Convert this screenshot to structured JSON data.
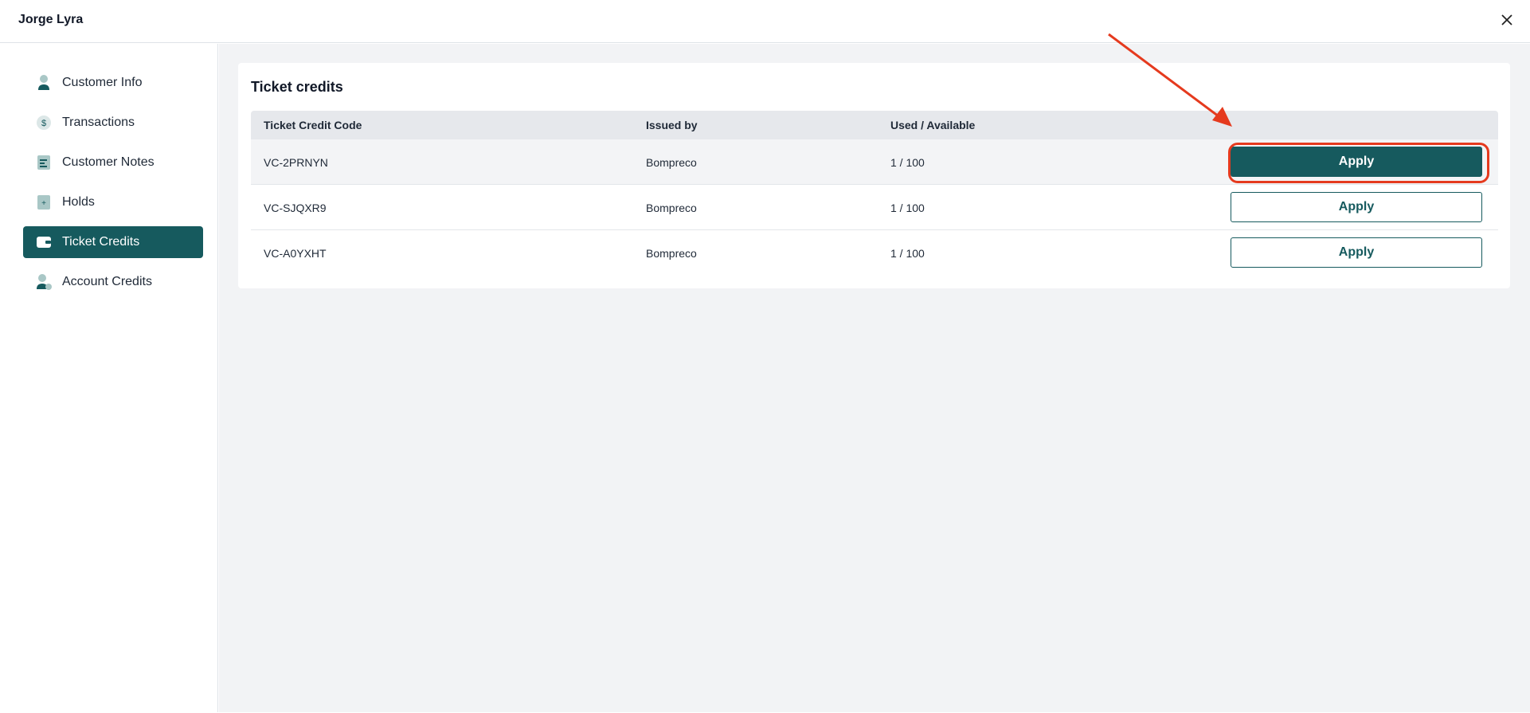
{
  "header": {
    "title": "Jorge Lyra",
    "close_icon": "close-icon"
  },
  "sidebar": {
    "items": [
      {
        "label": "Customer Info",
        "icon": "person-icon",
        "active": false
      },
      {
        "label": "Transactions",
        "icon": "dollar-icon",
        "active": false
      },
      {
        "label": "Customer Notes",
        "icon": "notes-icon",
        "active": false
      },
      {
        "label": "Holds",
        "icon": "hold-icon",
        "active": false
      },
      {
        "label": "Ticket Credits",
        "icon": "wallet-icon",
        "active": true
      },
      {
        "label": "Account Credits",
        "icon": "account-credit-icon",
        "active": false
      }
    ]
  },
  "main": {
    "card_title": "Ticket credits",
    "table": {
      "headers": [
        "Ticket Credit Code",
        "Issued by",
        "Used / Available"
      ],
      "rows": [
        {
          "code": "VC-2PRNYN",
          "issued_by": "Bompreco",
          "used_available": "1 / 100",
          "action": "Apply"
        },
        {
          "code": "VC-SJQXR9",
          "issued_by": "Bompreco",
          "used_available": "1 / 100",
          "action": "Apply"
        },
        {
          "code": "VC-A0YXHT",
          "issued_by": "Bompreco",
          "used_available": "1 / 100",
          "action": "Apply"
        }
      ]
    }
  },
  "colors": {
    "accent": "#165a5e",
    "annotation": "#e53a1e",
    "background": "#f2f3f5"
  }
}
